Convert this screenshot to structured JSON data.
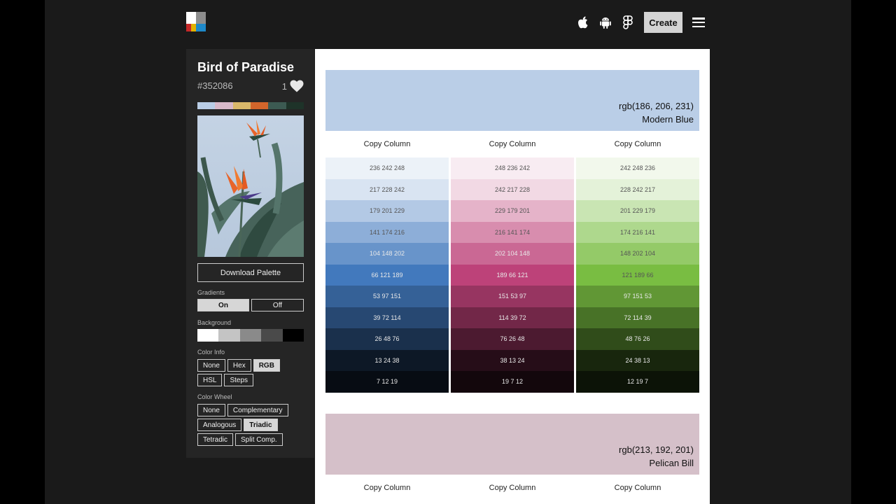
{
  "header": {
    "create_label": "Create",
    "icons": [
      "logo-icon",
      "apple-icon",
      "android-icon",
      "figma-icon",
      "menu-icon"
    ]
  },
  "palette": {
    "title": "Bird of Paradise",
    "hex": "#352086",
    "likes": "1",
    "strip_colors": [
      "#b9cde6",
      "#d8b9c9",
      "#d9b86a",
      "#d2652b",
      "#3c5a52",
      "#1e3329"
    ]
  },
  "sidebar": {
    "download_label": "Download Palette",
    "gradients": {
      "label": "Gradients",
      "options": [
        "On",
        "Off"
      ],
      "selected": "On"
    },
    "background": {
      "label": "Background",
      "swatches": [
        "#ffffff",
        "#c4c4c4",
        "#8a8a8a",
        "#4a4a4a",
        "#000000"
      ]
    },
    "color_info": {
      "label": "Color Info",
      "options": [
        "None",
        "Hex",
        "RGB",
        "HSL",
        "Steps"
      ],
      "selected": "RGB"
    },
    "color_wheel": {
      "label": "Color Wheel",
      "options": [
        "None",
        "Complementary",
        "Analogous",
        "Triadic",
        "Tetradic",
        "Split Comp."
      ],
      "selected": "Triadic"
    }
  },
  "sections": [
    {
      "rgb": "rgb(186, 206, 231)",
      "name": "Modern Blue",
      "color": "#bacee7",
      "copy_label": "Copy Column",
      "columns": [
        [
          "236 242 248",
          "217 228 242",
          "179 201 229",
          "141 174 216",
          "104 148 202",
          "66 121 189",
          "53 97 151",
          "39 72 114",
          "26 48 76",
          "13 24 38",
          "7 12 19"
        ],
        [
          "248 236 242",
          "242 217 228",
          "229 179 201",
          "216 141 174",
          "202 104 148",
          "189 66 121",
          "151 53 97",
          "114 39 72",
          "76 26 48",
          "38 13 24",
          "19 7 12"
        ],
        [
          "242 248 236",
          "228 242 217",
          "201 229 179",
          "174 216 141",
          "148 202 104",
          "121 189 66",
          "97 151 53",
          "72 114 39",
          "48 76 26",
          "24 38 13",
          "12 19 7"
        ]
      ]
    },
    {
      "rgb": "rgb(213, 192, 201)",
      "name": "Pelican Bill",
      "color": "#d5c0c9",
      "copy_label": "Copy Column",
      "columns": [
        [],
        [],
        []
      ]
    }
  ]
}
